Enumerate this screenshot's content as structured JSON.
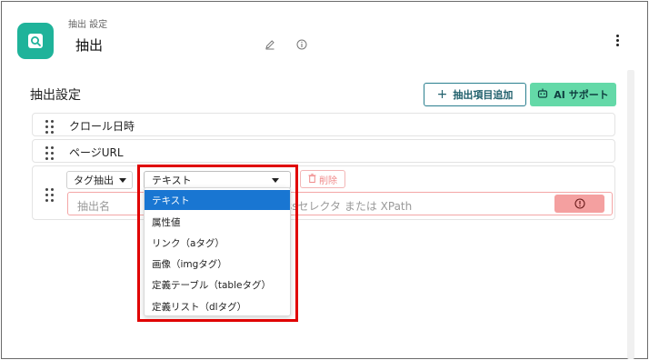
{
  "header": {
    "breadcrumb": "抽出 設定",
    "title": "抽出"
  },
  "section": {
    "title": "抽出設定",
    "add_button": "抽出項目追加",
    "ai_button": "AI サポート"
  },
  "items": [
    {
      "label": "クロール日時"
    },
    {
      "label": "ページURL"
    }
  ],
  "editor": {
    "tag_select": "タグ抽出",
    "type_select": "テキスト",
    "delete_button": "削除",
    "name_placeholder": "抽出名",
    "selector_placeholder": "ssセレクタ または XPath"
  },
  "dropdown": {
    "options": [
      "テキスト",
      "属性値",
      "リンク（aタグ）",
      "画像（imgタグ）",
      "定義テーブル（tableタグ）",
      "定義リスト（dlタグ）"
    ],
    "selected": "テキスト"
  },
  "colors": {
    "brand": "#1fb39a",
    "ai_button": "#64d9a8",
    "highlight": "#e00000",
    "selected_option": "#1976d2",
    "error": "#f4a0a0"
  }
}
